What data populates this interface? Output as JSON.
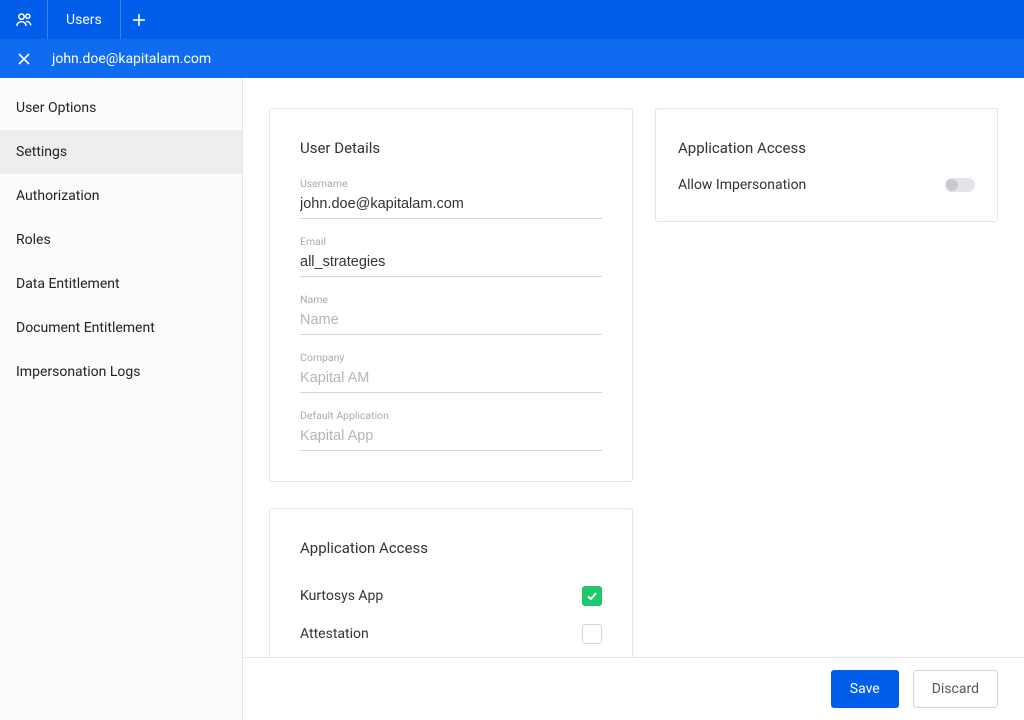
{
  "topbar": {
    "tab_label": "Users"
  },
  "subbar": {
    "title": "john.doe@kapitalam.com"
  },
  "sidebar": {
    "items": [
      {
        "label": "User Options",
        "active": false
      },
      {
        "label": "Settings",
        "active": true
      },
      {
        "label": "Authorization",
        "active": false
      },
      {
        "label": "Roles",
        "active": false
      },
      {
        "label": "Data Entitlement",
        "active": false
      },
      {
        "label": "Document Entitlement",
        "active": false
      },
      {
        "label": "Impersonation Logs",
        "active": false
      }
    ]
  },
  "details": {
    "title": "User Details",
    "fields": {
      "username": {
        "label": "Username",
        "value": "john.doe@kapitalam.com",
        "placeholder": ""
      },
      "email": {
        "label": "Email",
        "value": "all_strategies",
        "placeholder": ""
      },
      "name": {
        "label": "Name",
        "value": "",
        "placeholder": "Name"
      },
      "company": {
        "label": "Company",
        "value": "",
        "placeholder": "Kapital AM"
      },
      "default_app": {
        "label": "Default Application",
        "value": "",
        "placeholder": "Kapital App"
      }
    }
  },
  "impersonation_card": {
    "title": "Application Access",
    "row_label": "Allow Impersonation",
    "enabled": false
  },
  "access_card": {
    "title": "Application Access",
    "rows": [
      {
        "label": "Kurtosys App",
        "checked": true
      },
      {
        "label": "Attestation",
        "checked": false
      }
    ]
  },
  "footer": {
    "save_label": "Save",
    "discard_label": "Discard"
  }
}
